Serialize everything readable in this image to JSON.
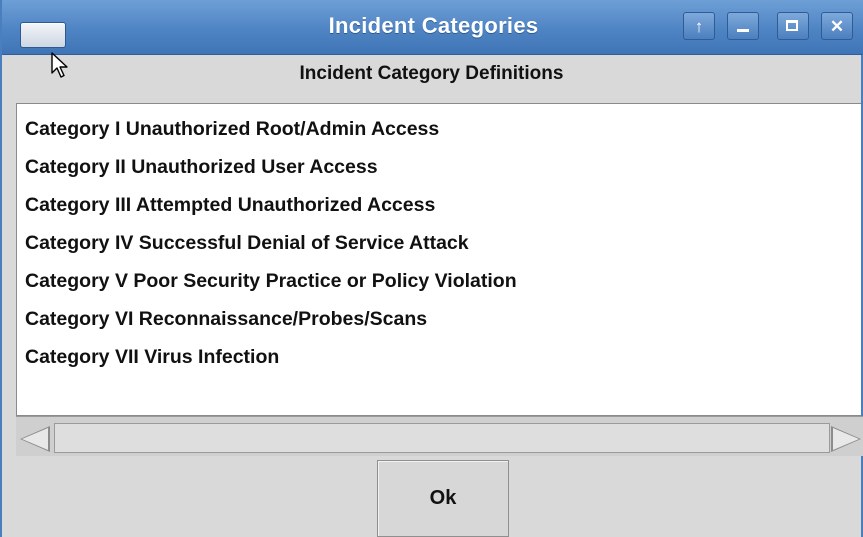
{
  "window": {
    "title": "Incident Categories",
    "controls": {
      "up_icon": "arrow-up-icon",
      "minimize_icon": "minimize-icon",
      "maximize_icon": "maximize-icon",
      "close_icon": "close-icon",
      "up_glyph": "↑",
      "close_glyph": "✕"
    }
  },
  "header": {
    "label": "Incident Category Definitions"
  },
  "categories": [
    "Category I Unauthorized Root/Admin Access",
    "Category II Unauthorized User Access",
    "Category III Attempted Unauthorized Access",
    "Category IV Successful Denial of Service Attack",
    "Category V Poor Security Practice or Policy Violation",
    "Category VI Reconnaissance/Probes/Scans",
    "Category VII Virus Infection"
  ],
  "footer": {
    "ok_label": "Ok"
  },
  "colors": {
    "titlebar": "#4f84c4",
    "window_bg": "#d9d9d9",
    "list_bg": "#ffffff"
  }
}
